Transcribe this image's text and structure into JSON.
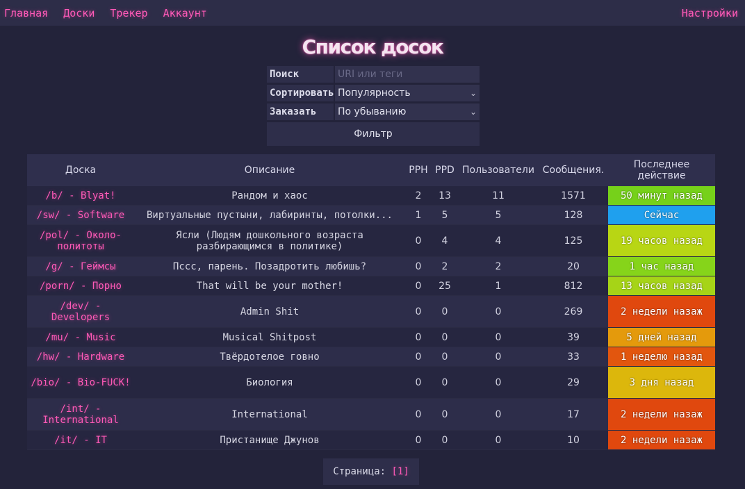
{
  "nav": {
    "items": [
      "Главная",
      "Доски",
      "Трекер",
      "Аккаунт"
    ],
    "settings": "Настройки"
  },
  "page_title": "Список досок",
  "filters": {
    "search_label": "Поиск",
    "search_placeholder": "URI или теги",
    "sort_label": "Сортировать",
    "sort_value": "Популярность",
    "order_label": "Заказать",
    "order_value": "По убыванию",
    "filter_button": "Фильтр"
  },
  "table": {
    "headers": [
      "Доска",
      "Описание",
      "PPH",
      "PPD",
      "Пользователи",
      "Сообщения.",
      "Последнее действие"
    ],
    "rows": [
      {
        "board": "/b/ - Blyat!",
        "desc": "Рандом и хаос",
        "pph": "2",
        "ppd": "13",
        "users": "11",
        "posts": "1571",
        "last": "50 минут назад",
        "color": "#76d11a"
      },
      {
        "board": "/sw/ - Software",
        "desc": "Виртуальные пустыни, лабиринты, потолки...",
        "pph": "1",
        "ppd": "5",
        "users": "5",
        "posts": "128",
        "last": "Сейчас",
        "color": "#1fa0ee"
      },
      {
        "board": "/pol/ - Около-политоты",
        "desc": "Ясли (Людям дошкольного возраста разбирающимся в политике)",
        "pph": "0",
        "ppd": "4",
        "users": "4",
        "posts": "125",
        "last": "19 часов назад",
        "color": "#b8d614"
      },
      {
        "board": "/g/ - Геймсы",
        "desc": "Пссс, парень. Позадротить любишь?",
        "pph": "0",
        "ppd": "2",
        "users": "2",
        "posts": "20",
        "last": "1 час назад",
        "color": "#86d41a"
      },
      {
        "board": "/porn/ - Порно",
        "desc": "That will be your mother!",
        "pph": "0",
        "ppd": "25",
        "users": "1",
        "posts": "812",
        "last": "13 часов назад",
        "color": "#a6d417"
      },
      {
        "board": "/dev/ - Developers",
        "desc": "Admin Shit",
        "pph": "0",
        "ppd": "0",
        "users": "0",
        "posts": "269",
        "last": "2 недели назаж",
        "color": "#e0480e"
      },
      {
        "board": "/mu/ - Music",
        "desc": "Musical Shitpost",
        "pph": "0",
        "ppd": "0",
        "users": "0",
        "posts": "39",
        "last": "5 дней назад",
        "color": "#e49a0c"
      },
      {
        "board": "/hw/ - Hardware",
        "desc": "Твёрдотелое говно",
        "pph": "0",
        "ppd": "0",
        "users": "0",
        "posts": "33",
        "last": "1 неделю назад",
        "color": "#e2560e"
      },
      {
        "board": "/bio/ - Bio-FUCK!",
        "desc": "Биология",
        "pph": "0",
        "ppd": "0",
        "users": "0",
        "posts": "29",
        "last": "3 дня назад",
        "color": "#dcb70c"
      },
      {
        "board": "/int/ - International",
        "desc": "International",
        "pph": "0",
        "ppd": "0",
        "users": "0",
        "posts": "17",
        "last": "2 недели назаж",
        "color": "#e0480e"
      },
      {
        "board": "/it/ - IT",
        "desc": "Пристанище Джунов",
        "pph": "0",
        "ppd": "0",
        "users": "0",
        "posts": "10",
        "last": "2 недели назаж",
        "color": "#e0480e"
      }
    ]
  },
  "pager": {
    "label": "Страница:",
    "current": "[1]"
  }
}
